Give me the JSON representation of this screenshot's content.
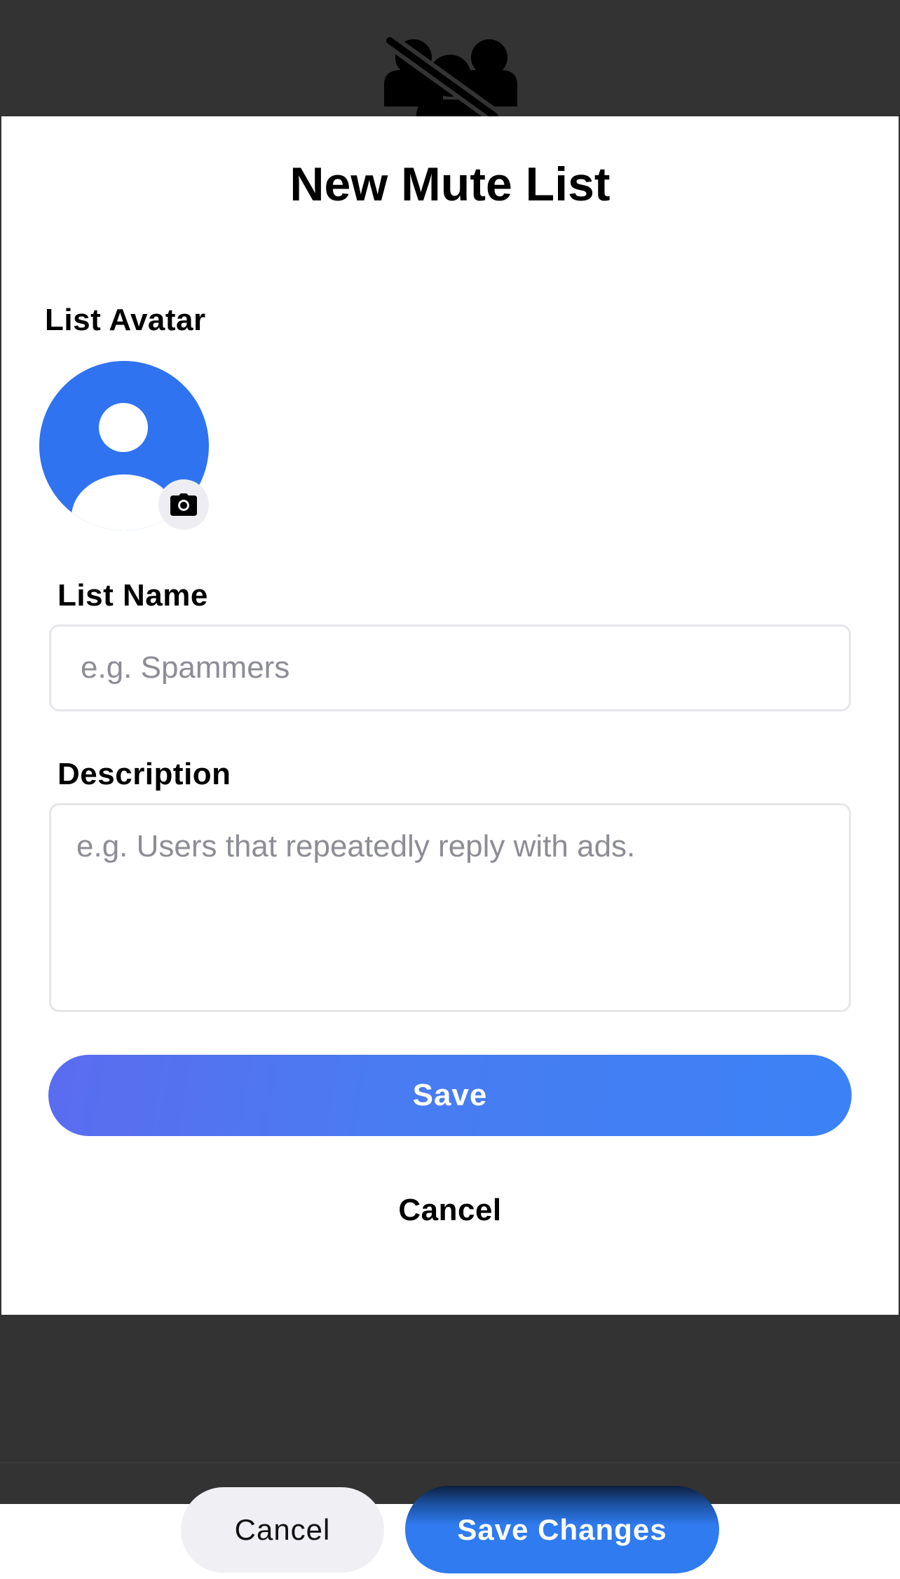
{
  "backdrop": {
    "icon": "muted-group-icon",
    "bottom_bar": {
      "cancel_label": "Cancel",
      "save_label": "Save Changes"
    }
  },
  "modal": {
    "title": "New Mute List",
    "avatar": {
      "label": "List Avatar",
      "icon": "camera-icon",
      "color": "#2f73f0"
    },
    "name": {
      "label": "List Name",
      "value": "",
      "placeholder": "e.g. Spammers"
    },
    "description": {
      "label": "Description",
      "value": "",
      "placeholder": "e.g. Users that repeatedly reply with ads."
    },
    "save_label": "Save",
    "cancel_label": "Cancel"
  },
  "colors": {
    "accent": "#3b82f6",
    "backdrop": "#333333",
    "placeholder": "#8d8d96"
  }
}
